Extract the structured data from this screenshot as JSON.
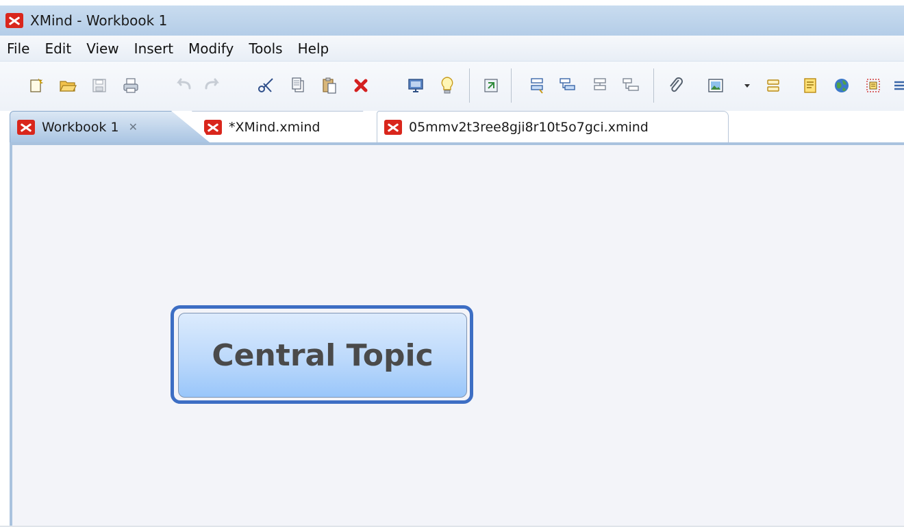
{
  "window": {
    "title": "XMind - Workbook 1"
  },
  "menu": {
    "items": [
      "File",
      "Edit",
      "View",
      "Insert",
      "Modify",
      "Tools",
      "Help"
    ]
  },
  "toolbar": {
    "buttons": [
      {
        "name": "new-workbook",
        "glyph": "📄"
      },
      {
        "name": "open",
        "glyph": "📂"
      },
      {
        "name": "save",
        "glyph": "💾"
      },
      {
        "name": "print",
        "glyph": "🖨"
      },
      {
        "name": "undo",
        "glyph": "↶"
      },
      {
        "name": "redo",
        "glyph": "↷"
      },
      {
        "name": "cut",
        "glyph": "✂"
      },
      {
        "name": "copy",
        "glyph": "📋"
      },
      {
        "name": "paste",
        "glyph": "📋"
      },
      {
        "name": "delete",
        "glyph": "✖"
      },
      {
        "name": "presentation",
        "glyph": "🖥"
      },
      {
        "name": "brainstorm",
        "glyph": "💡"
      },
      {
        "name": "drill-down",
        "glyph": "⇲"
      },
      {
        "name": "insert-topic",
        "glyph": "▭"
      },
      {
        "name": "insert-subtopic",
        "glyph": "▭"
      },
      {
        "name": "insert-topic-before",
        "glyph": "▭"
      },
      {
        "name": "insert-parent-topic",
        "glyph": "▭"
      },
      {
        "name": "attachment",
        "glyph": "📎"
      },
      {
        "name": "image",
        "glyph": "🖼"
      },
      {
        "name": "dropdown",
        "glyph": "▾"
      },
      {
        "name": "summary",
        "glyph": "☰"
      },
      {
        "name": "notes",
        "glyph": "📝"
      },
      {
        "name": "hyperlink",
        "glyph": "🌐"
      },
      {
        "name": "boundary",
        "glyph": "▣"
      },
      {
        "name": "more",
        "glyph": "≡"
      }
    ]
  },
  "tabs": [
    {
      "label": "Workbook 1",
      "active": true,
      "close": "✕"
    },
    {
      "label": "*XMind.xmind",
      "active": false
    },
    {
      "label": "05mmv2t3ree8gji8r10t5o7gci.xmind",
      "active": false
    }
  ],
  "canvas": {
    "central_topic": "Central Topic"
  },
  "colors": {
    "accent": "#3d6ec4",
    "logo": "#d9261c",
    "canvas_bg": "#f3f4f9"
  }
}
